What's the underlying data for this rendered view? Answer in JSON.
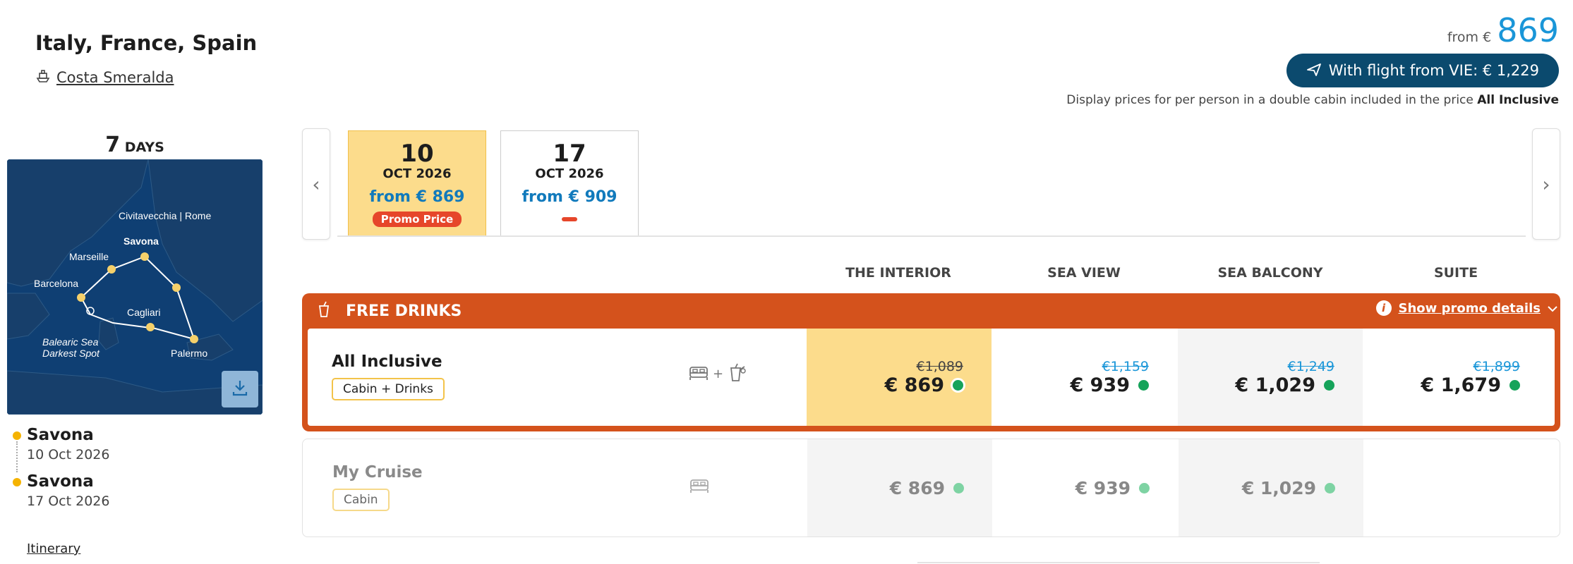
{
  "header": {
    "title": "Italy, France, Spain",
    "ship_name": "Costa Smeralda",
    "from_label": "from €",
    "from_price": "869",
    "flight_button": "With flight from VIE: € 1,229",
    "display_note": "Display prices for per person in a double cabin included in the price",
    "display_note_bold": "All Inclusive"
  },
  "left": {
    "days_num": "7",
    "days_label": "DAYS",
    "map_labels": {
      "civitavecchia": "Civitavecchia | Rome",
      "savona": "Savona",
      "marseille": "Marseille",
      "barcelona": "Barcelona",
      "cagliari": "Cagliari",
      "balearic1": "Balearic Sea",
      "balearic2": "Darkest Spot",
      "palermo": "Palermo"
    },
    "ports": [
      {
        "name": "Savona",
        "date": "10 Oct 2026"
      },
      {
        "name": "Savona",
        "date": "17 Oct 2026"
      }
    ],
    "itinerary_link": "Itinerary"
  },
  "dates": [
    {
      "day": "10",
      "month": "OCT 2026",
      "price": "from € 869",
      "promo": "Promo Price"
    },
    {
      "day": "17",
      "month": "OCT 2026",
      "price": "from € 909"
    }
  ],
  "columns": [
    "THE INTERIOR",
    "SEA VIEW",
    "SEA BALCONY",
    "SUITE"
  ],
  "promo": {
    "title": "FREE DRINKS",
    "details_link": "Show promo details",
    "row_title": "All Inclusive",
    "row_tag": "Cabin + Drinks",
    "prices": [
      {
        "old": "€1,089",
        "new": "€ 869"
      },
      {
        "old": "€1,159",
        "new": "€ 939"
      },
      {
        "old": "€1,249",
        "new": "€ 1,029"
      },
      {
        "old": "€1,899",
        "new": "€ 1,679"
      }
    ]
  },
  "cruise": {
    "row_title": "My Cruise",
    "row_tag": "Cabin",
    "prices": [
      "€ 869",
      "€ 939",
      "€ 1,029"
    ]
  },
  "colors": {
    "accent_blue": "#1a96d8",
    "promo_orange": "#d4521c",
    "selected_yellow": "#fcdc8c",
    "flight_navy": "#0b4a6e",
    "available_green": "#16a35a"
  }
}
